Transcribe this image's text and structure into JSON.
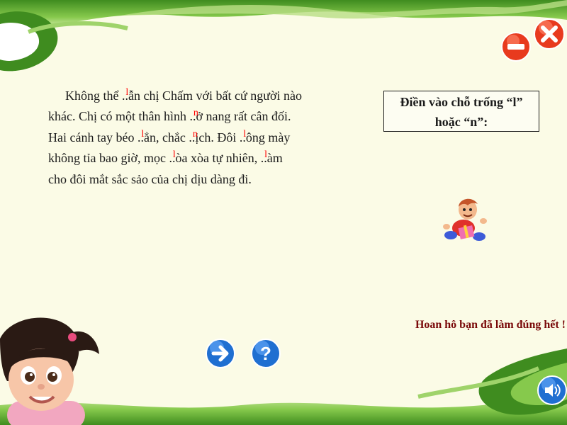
{
  "passage": {
    "lines": [
      [
        {
          "t": "Không thể "
        },
        {
          "blank": "..",
          "ans": "l"
        },
        {
          "t": "ẫn chị Chấm với bất cứ người nào"
        }
      ],
      [
        {
          "t": "khác. Chị có một thân hình "
        },
        {
          "blank": "..",
          "ans": "n"
        },
        {
          "t": "ở nang rất cân đối."
        }
      ],
      [
        {
          "t": "Hai cánh tay béo "
        },
        {
          "blank": "..",
          "ans": "l"
        },
        {
          "t": "ẳn, chắc "
        },
        {
          "blank": "..",
          "ans": "n"
        },
        {
          "t": "ịch. Đôi "
        },
        {
          "blank": "..",
          "ans": "l"
        },
        {
          "t": "ông mày"
        }
      ],
      [
        {
          "t": "không tỉa bao giờ, mọc "
        },
        {
          "blank": "..",
          "ans": "l"
        },
        {
          "t": "òa xòa tự nhiên, "
        },
        {
          "blank": "..",
          "ans": "l"
        },
        {
          "t": "àm"
        }
      ],
      [
        {
          "t": "cho đôi mắt sắc sảo của chị dịu dàng đi."
        }
      ]
    ]
  },
  "instruction": {
    "line1": "Điền vào chỗ trống “l”",
    "line2": "hoặc “n”:"
  },
  "congrats": "Hoan hô bạn đã làm đúng hết !",
  "icons": {
    "close": "close-icon",
    "minimize": "minimize-icon",
    "next": "arrow-right-icon",
    "help": "question-icon",
    "sound": "speaker-icon"
  },
  "colors": {
    "background": "#fbfbe6",
    "frame_green": "#6fb43a",
    "answer_red": "#ff0000",
    "congrats_text": "#7a0a0a",
    "button_blue": "#1f6fd1",
    "close_red": "#e83a1e"
  }
}
